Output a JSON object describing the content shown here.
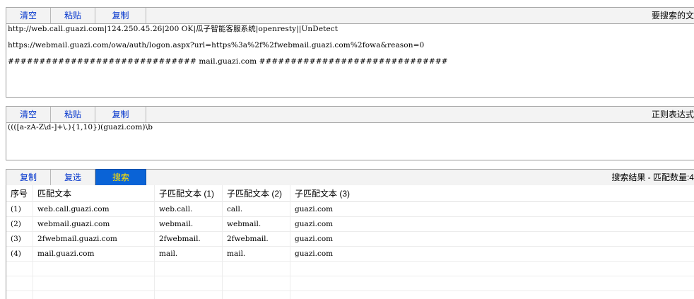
{
  "input_panel": {
    "buttons": [
      "清空",
      "粘贴",
      "复制"
    ],
    "title": "要搜索的文",
    "lines": [
      "http://web.call.guazi.com|124.250.45.26|200 OK|瓜子智能客服系统|openresty||UnDetect",
      "",
      "https://webmail.guazi.com/owa/auth/logon.aspx?url=https%3a%2f%2fwebmail.guazi.com%2fowa&reason=0",
      "",
      "############################## mail.guazi.com ##############################"
    ]
  },
  "regex_panel": {
    "buttons": [
      "清空",
      "粘贴",
      "复制"
    ],
    "title": "正则表达式",
    "pattern": "((([a-zA-Z\\d-]+\\.){1,10})(guazi.com)\\b"
  },
  "results_panel": {
    "buttons": [
      "复制",
      "复选",
      "搜索"
    ],
    "active_button": "搜索",
    "title": "搜索结果 - 匹配数量:4",
    "columns": [
      "序号",
      "匹配文本",
      "子匹配文本 (1)",
      "子匹配文本 (2)",
      "子匹配文本 (3)"
    ],
    "rows": [
      [
        "(1)",
        "web.call.guazi.com",
        "web.call.",
        "call.",
        "guazi.com"
      ],
      [
        "(2)",
        "webmail.guazi.com",
        "webmail.",
        "webmail.",
        "guazi.com"
      ],
      [
        "(3)",
        "2fwebmail.guazi.com",
        "2fwebmail.",
        "2fwebmail.",
        "guazi.com"
      ],
      [
        "(4)",
        "mail.guazi.com",
        "mail.",
        "mail.",
        "guazi.com"
      ]
    ]
  },
  "colors": {
    "button_text": "#0033cc",
    "active_bg": "#0a63d6",
    "active_text": "#ffe000"
  }
}
